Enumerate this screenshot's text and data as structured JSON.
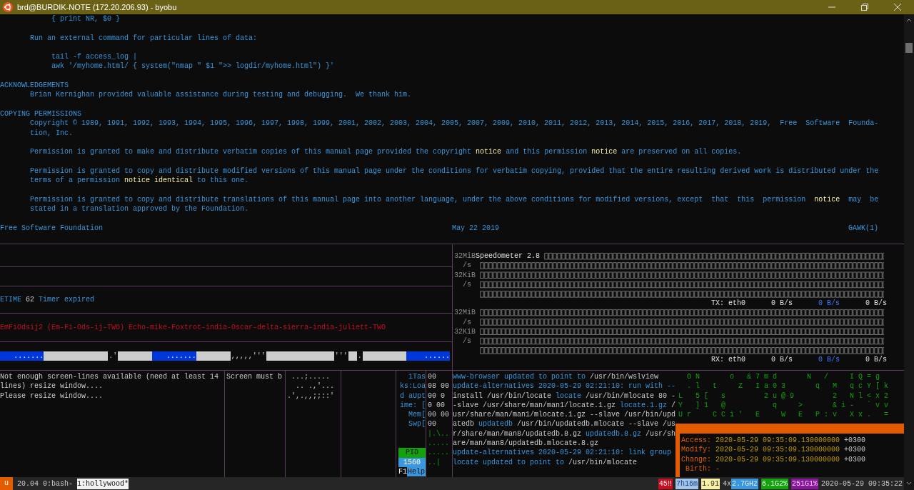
{
  "window": {
    "title": "brd@BURDIK-NOTE (172.20.206.93) - byobu"
  },
  "man_page": {
    "paragraphs": [
      {
        "lines": [
          {
            "kind": "code",
            "segments": [
              {
                "kind": "text",
                "text": "{ print NR, $0 }"
              }
            ]
          }
        ]
      },
      {
        "lines": [
          {
            "kind": "body",
            "segments": [
              {
                "kind": "text",
                "text": "Run an external command for particular lines of data:"
              }
            ]
          }
        ]
      },
      {
        "lines": [
          {
            "kind": "code",
            "segments": [
              {
                "kind": "text",
                "text": "tail -f access_log |"
              }
            ]
          },
          {
            "kind": "code",
            "segments": [
              {
                "kind": "text",
                "text": "awk '/myhome.html/ { system(\"nmap \" $1 \">> logdir/myhome.html\") }'"
              }
            ]
          }
        ]
      },
      {
        "lines": [
          {
            "kind": "section",
            "segments": [
              {
                "kind": "text",
                "text": "ACKNOWLEDGEMENTS"
              }
            ]
          },
          {
            "kind": "body",
            "segments": [
              {
                "kind": "text",
                "text": "Brian Kernighan provided valuable assistance during testing and debugging.  We thank him."
              }
            ]
          }
        ]
      },
      {
        "lines": [
          {
            "kind": "section",
            "segments": [
              {
                "kind": "text",
                "text": "COPYING PERMISSIONS"
              }
            ]
          },
          {
            "kind": "body",
            "segments": [
              {
                "kind": "text",
                "text": "Copyright © 1989, 1991, 1992, 1993, 1994, 1995, 1996, 1997, 1998, 1999, 2001, 2002, 2003, 2004, 2005, 2007, 2009, 2010, 2011, 2012, 2013, 2014, 2015, 2016, 2017, 2018, 2019,  Free  Software  Founda-"
              }
            ]
          },
          {
            "kind": "body",
            "segments": [
              {
                "kind": "text",
                "text": "tion, Inc."
              }
            ]
          }
        ]
      },
      {
        "lines": [
          {
            "kind": "body",
            "segments": [
              {
                "kind": "text",
                "text": "Permission is granted to make and distribute verbatim copies of this manual page provided the copyright "
              },
              {
                "kind": "notice",
                "text": "notice"
              },
              {
                "kind": "text",
                "text": " and this permission "
              },
              {
                "kind": "notice",
                "text": "notice"
              },
              {
                "kind": "text",
                "text": " are preserved on all copies."
              }
            ]
          }
        ]
      },
      {
        "lines": [
          {
            "kind": "body",
            "segments": [
              {
                "kind": "text",
                "text": "Permission is granted to copy and distribute modified versions of this manual page under the conditions for verbatim copying, provided that the entire resulting derived work is distributed under the"
              }
            ]
          },
          {
            "kind": "body",
            "segments": [
              {
                "kind": "text",
                "text": "terms of a permission "
              },
              {
                "kind": "notice",
                "text": "notice identical"
              },
              {
                "kind": "text",
                "text": " to this one."
              }
            ]
          }
        ]
      },
      {
        "lines": [
          {
            "kind": "body",
            "segments": [
              {
                "kind": "text",
                "text": "Permission is granted to copy and distribute translations of this manual page into another language, under the above conditions for modified versions, except  that  this  permission  "
              },
              {
                "kind": "notice",
                "text": "notice"
              },
              {
                "kind": "text",
                "text": "  may  be"
              }
            ]
          },
          {
            "kind": "body",
            "segments": [
              {
                "kind": "text",
                "text": "stated in a translation approved by the Foundation."
              }
            ]
          }
        ]
      }
    ],
    "footer": [
      "Free Software Foundation",
      "May 22 2019",
      "GAWK(1)"
    ]
  },
  "timer": [
    {
      "kind": "label",
      "text": "ETIME"
    },
    {
      "kind": "value",
      "text": "62"
    },
    {
      "kind": "label",
      "text": "Timer expired"
    }
  ],
  "callsign": "EmFiOdsij2 (Em-Fi-Ods-ij-TWO) Echo-mike-Foxtrot-india-Oscar-delta-sierra-india-juliett-TWO",
  "bar": [
    {
      "kind": "blue",
      "text": "......."
    },
    {
      "kind": "gray"
    },
    {
      "kind": "plain",
      "text": ".'"
    },
    {
      "kind": "gray"
    },
    {
      "kind": "blue",
      "text": "......."
    },
    {
      "kind": "gray"
    },
    {
      "kind": "plain",
      "text": ",,,,,'''"
    },
    {
      "kind": "gray"
    },
    {
      "kind": "plain",
      "text": "'''"
    },
    {
      "kind": "gray"
    },
    {
      "kind": "plain",
      "text": "."
    },
    {
      "kind": "gray"
    },
    {
      "kind": "blue",
      "text": "......"
    }
  ],
  "speedometer": {
    "title": "Speedometer 2.8",
    "graphs": [
      {
        "axis_labels": [
          "32MiB",
          "/s",
          "32KiB",
          "/s"
        ],
        "direction": "TX:",
        "interface": "eth0",
        "readings": [
          "0 B/s",
          "0 B/s",
          "0 B/s"
        ]
      },
      {
        "axis_labels": [
          "32MiB",
          "/s",
          "32KiB",
          "/s"
        ],
        "direction": "RX:",
        "interface": "eth0",
        "readings": [
          "0 B/s",
          "0 B/s",
          "0 B/s"
        ]
      }
    ]
  },
  "resize_message": [
    "Not enough screen-lines available (need at least 14",
    "lines) resize window....",
    "Please resize window...."
  ],
  "screen_message": "Screen must b",
  "ascii_art": [
    " ...;.....",
    "  .. .,'...",
    ".',.,,;;::'"
  ],
  "htop": {
    "meters": [
      "1Tas",
      "ks:Loa",
      "d aUpt",
      "ime: [",
      "Mem[",
      "Swp["
    ],
    "pid_header": "PID",
    "pid": "1560",
    "help_key": "F1",
    "help_label": "Help"
  },
  "columns": [
    "00",
    "08 00",
    "00 0",
    "0 00",
    "00 00",
    "00",
    "|.\\..",
    ".....",
    ".....",
    "..|"
  ],
  "log": [
    [
      {
        "kind": "blue",
        "text": "www-browser updated to point to "
      },
      {
        "kind": "white",
        "text": "/usr/bin/wslview"
      }
    ],
    [
      {
        "kind": "blue",
        "text": "update-alternatives 2020-05-29 02:21:10: run with --"
      }
    ],
    [
      {
        "kind": "white",
        "text": "install /usr/bin/locate "
      },
      {
        "kind": "blue",
        "text": "locate "
      },
      {
        "kind": "white",
        "text": "/usr/bin/mlocate 80 -"
      }
    ],
    [
      {
        "kind": "white",
        "text": "-slave /usr/share/man/man1/locate.1.gz "
      },
      {
        "kind": "blue",
        "text": "locate.1.gz "
      },
      {
        "kind": "white",
        "text": "/"
      }
    ],
    [
      {
        "kind": "white",
        "text": "usr/share/man/man1/mlocate.1.gz --slave /usr/bin/upd"
      }
    ],
    [
      {
        "kind": "white",
        "text": "atedb "
      },
      {
        "kind": "blue",
        "text": "updatedb "
      },
      {
        "kind": "white",
        "text": "/usr/bin/updatedb.mlocate --slave /us"
      }
    ],
    [
      {
        "kind": "white",
        "text": "r/share/man/man8/updatedb.8.gz "
      },
      {
        "kind": "blue",
        "text": "updatedb.8.gz "
      },
      {
        "kind": "white",
        "text": "/usr/sh"
      }
    ],
    [
      {
        "kind": "white",
        "text": "are/man/man8/updatedb.mlocate.8.gz"
      }
    ],
    [
      {
        "kind": "blue",
        "text": "update-alternatives 2020-05-29 02:21:10: link group"
      }
    ],
    [
      {
        "kind": "blue",
        "text": "locate updated to point to "
      },
      {
        "kind": "white",
        "text": "/usr/bin/mlocate"
      }
    ]
  ],
  "matrix": [
    "  O N       o   & 7 m d       N   /     I Q = g",
    "  . l   t     Z   I a 0 3       q   M   q c Y [ k",
    "L   5 [   s         2 u @ 9         2   N l < x 2",
    "Y   ] 1   @           q     >       & i -   ` v v",
    "U r     C C i '   E     W   E   P : v   X x .   ="
  ],
  "stat": [
    {
      "label": "Access:",
      "date": "2020-05-29 09:35:09.130000000",
      "zone": "+0300"
    },
    {
      "label": "Modify:",
      "date": "2020-05-29 09:35:09.130000000",
      "zone": "+0300"
    },
    {
      "label": "Change:",
      "date": "2020-05-29 09:35:09.130000000",
      "zone": "+0300"
    },
    {
      "label": " Birth:",
      "date": "-"
    }
  ],
  "status_bar": {
    "logo": "u",
    "release": "20.04",
    "windows": [
      {
        "label": "0:bash-",
        "selected": false
      },
      {
        "label": "1:hollywood*",
        "selected": true
      }
    ],
    "indicators": [
      {
        "kind": "red",
        "text": "45‼"
      },
      {
        "kind": "uptime",
        "text": "7h16m"
      },
      {
        "kind": "load",
        "text": "1.91"
      },
      {
        "kind": "plain",
        "text": "4x"
      },
      {
        "kind": "cpu",
        "text": "2.7GHz"
      },
      {
        "kind": "mem",
        "text": "6.1G2%"
      },
      {
        "kind": "disk",
        "text": "251G1%"
      },
      {
        "kind": "plain",
        "text": "2020-05-29 09:35:22"
      }
    ]
  }
}
